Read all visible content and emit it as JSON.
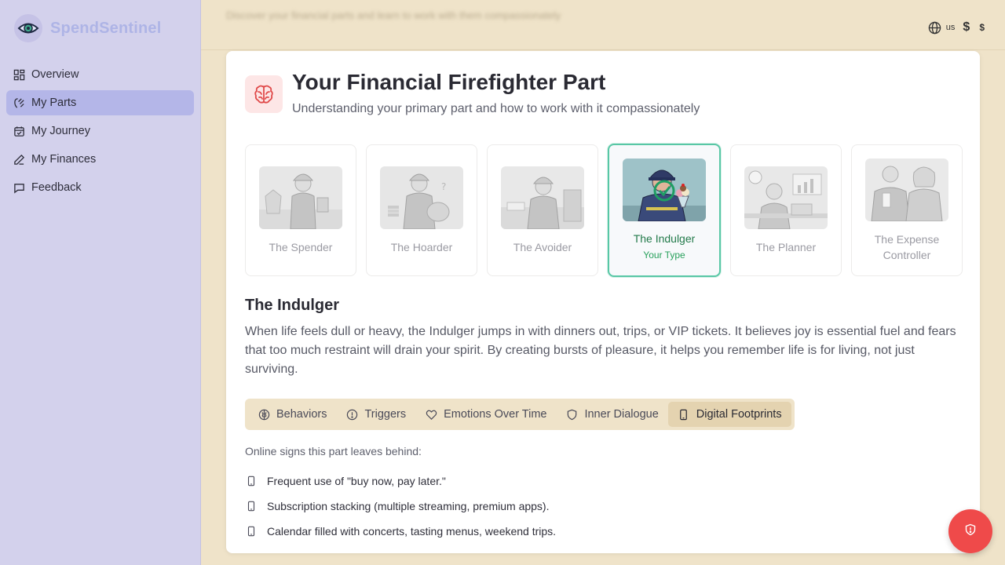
{
  "brand": {
    "name": "SpendSentinel",
    "icon": "eye-icon"
  },
  "sidebar": {
    "items": [
      {
        "label": "Overview",
        "icon": "dashboard-icon",
        "active": false
      },
      {
        "label": "My Parts",
        "icon": "brain-parts-icon",
        "active": true
      },
      {
        "label": "My Journey",
        "icon": "calendar-icon",
        "active": false
      },
      {
        "label": "My Finances",
        "icon": "pencil-icon",
        "active": false
      },
      {
        "label": "Feedback",
        "icon": "message-icon",
        "active": false
      }
    ]
  },
  "topbar": {
    "blurred_message": "Discover your financial parts and learn to work with them compassionately",
    "locale": "us",
    "currency_symbol": "$",
    "currency_symbol_small": "$"
  },
  "header": {
    "title": "Your Financial Firefighter Part",
    "subtitle": "Understanding your primary part and how to work with it compassionately",
    "icon": "brain-icon"
  },
  "types": [
    {
      "name": "The Spender",
      "selected": false
    },
    {
      "name": "The Hoarder",
      "selected": false
    },
    {
      "name": "The Avoider",
      "selected": false
    },
    {
      "name": "The Indulger",
      "selected": true,
      "badge": "Your Type"
    },
    {
      "name": "The Planner",
      "selected": false
    },
    {
      "name": "The Expense Controller",
      "selected": false
    }
  ],
  "section": {
    "title": "The Indulger",
    "description": "When life feels dull or heavy, the Indulger jumps in with dinners out, trips, or VIP tickets. It believes joy is essential fuel and fears that too much restraint will drain your spirit. By creating bursts of pleasure, it helps you remember life is for living, not just surviving."
  },
  "tabs": [
    {
      "label": "Behaviors",
      "icon": "brain-icon",
      "active": false
    },
    {
      "label": "Triggers",
      "icon": "alert-circle-icon",
      "active": false
    },
    {
      "label": "Emotions Over Time",
      "icon": "heart-icon",
      "active": false
    },
    {
      "label": "Inner Dialogue",
      "icon": "shield-icon",
      "active": false
    },
    {
      "label": "Digital Footprints",
      "icon": "smartphone-icon",
      "active": true
    }
  ],
  "footprints": {
    "intro": "Online signs this part leaves behind:",
    "items": [
      "Frequent use of \"buy now, pay later.\"",
      "Subscription stacking (multiple streaming, premium apps).",
      "Calendar filled with concerts, tasting menus, weekend trips."
    ]
  },
  "colors": {
    "sidebar_bg": "#d3d1ec",
    "page_bg": "#efe3c9",
    "accent_green": "#58c7a5",
    "fab_red": "#ef4a4a"
  },
  "fab": {
    "icon": "shield-alert-icon"
  }
}
